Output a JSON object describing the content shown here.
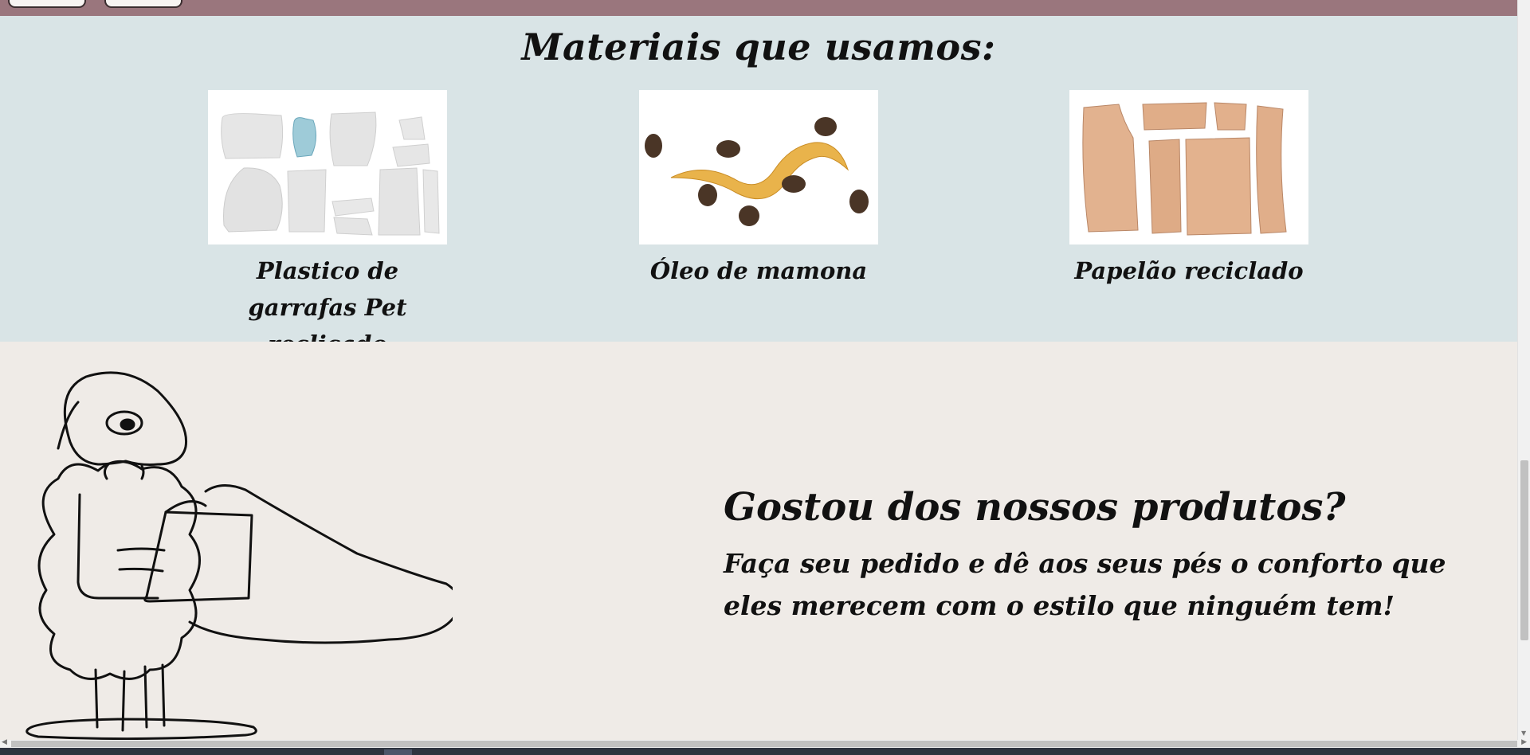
{
  "materials": {
    "title": "Materiais que usamos:",
    "items": [
      {
        "caption": "Plastico de garrafas Pet reclicado",
        "icon": "pet-bottle-plastic-image"
      },
      {
        "caption": "Óleo de mamona",
        "icon": "castor-oil-image"
      },
      {
        "caption": "Papelão reciclado",
        "icon": "recycled-cardboard-image"
      }
    ]
  },
  "cta": {
    "heading": "Gostou dos nossos produtos?",
    "text": "Faça seu pedido e dê aos seus pés o conforto que eles merecem com o estilo que ninguém tem!"
  },
  "colors": {
    "topbar": "#9a767d",
    "materials_bg": "#d9e4e6",
    "cta_bg": "#efebe7"
  }
}
